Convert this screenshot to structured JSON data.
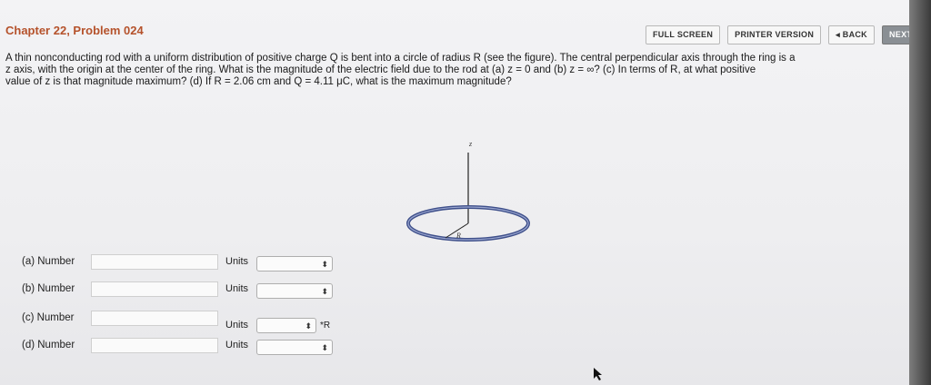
{
  "toolbar": {
    "full_screen": "FULL SCREEN",
    "printer_version": "PRINTER VERSION",
    "back": "◂ BACK",
    "next": "NEXT ▸"
  },
  "header": {
    "title": "Chapter 22, Problem 024"
  },
  "problem": {
    "line1": "A thin nonconducting rod with a uniform distribution of positive charge Q is bent into a circle of radius R (see the figure). The central perpendicular axis through the ring is a",
    "line2": "z axis, with the origin at the center of the ring. What is the magnitude of the electric field due to the rod at (a) z = 0 and (b) z = ∞? (c) In terms of R, at what positive",
    "line3": "value of z is that magnitude maximum? (d) If R = 2.06 cm and Q = 4.11 μC, what is the maximum magnitude?"
  },
  "figure": {
    "axis_label": "z",
    "radius_label": "R",
    "ring_color": "#4a5fa0"
  },
  "answers": {
    "rows": [
      {
        "label": "(a) Number",
        "value": "",
        "units_label": "Units",
        "units_value": "",
        "suffix": ""
      },
      {
        "label": "(b) Number",
        "value": "",
        "units_label": "Units",
        "units_value": "",
        "suffix": ""
      },
      {
        "label": "(c) Number",
        "value": "",
        "units_label": "Units",
        "units_value": "",
        "suffix": "*R"
      },
      {
        "label": "(d) Number",
        "value": "",
        "units_label": "Units",
        "units_value": "",
        "suffix": ""
      }
    ],
    "select_arrow": "⬍"
  }
}
